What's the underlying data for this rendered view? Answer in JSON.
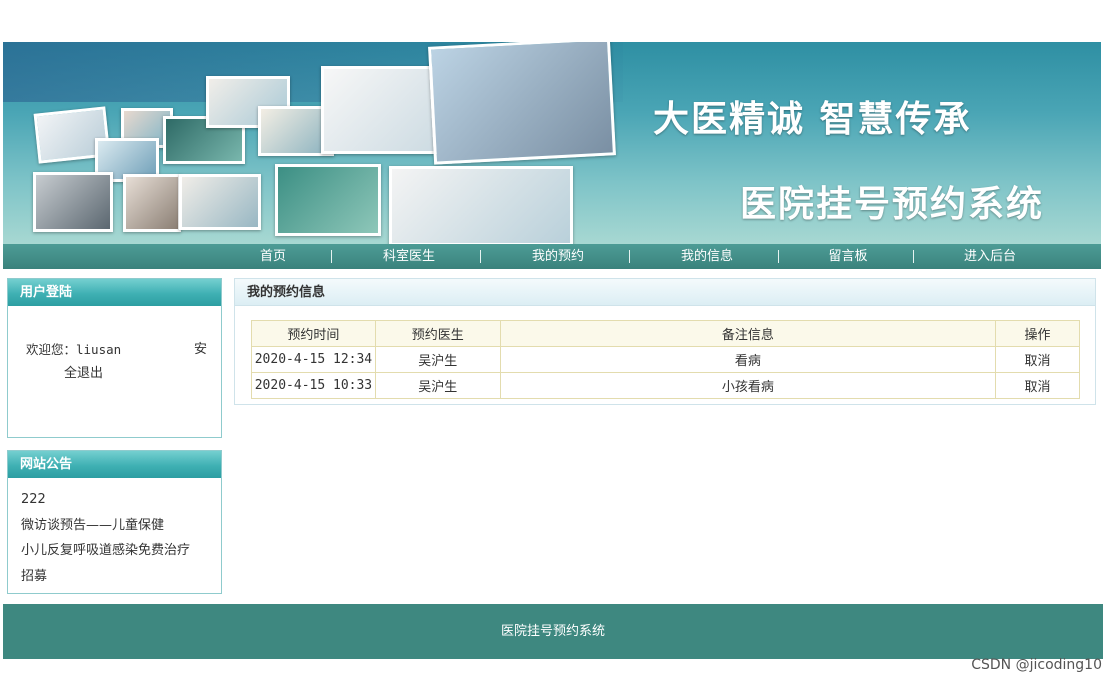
{
  "banner": {
    "slogan_top": "大医精诚 智慧传承",
    "slogan_bottom": "医院挂号预约系统"
  },
  "nav": {
    "items": [
      {
        "label": "首页"
      },
      {
        "label": "科室医生"
      },
      {
        "label": "我的预约"
      },
      {
        "label": "我的信息"
      },
      {
        "label": "留言板"
      },
      {
        "label": "进入后台"
      }
    ],
    "separator": "|"
  },
  "login_panel": {
    "title": "用户登陆",
    "welcome": "欢迎您：liusan",
    "logout_part1": "安",
    "logout_part2": "全退出"
  },
  "notice_panel": {
    "title": "网站公告",
    "items": [
      {
        "text": "222"
      },
      {
        "text": "微访谈预告——儿童保健"
      },
      {
        "text": "小儿反复呼吸道感染免费治疗"
      },
      {
        "text": "招募"
      }
    ]
  },
  "main": {
    "title": "我的预约信息",
    "columns": [
      "预约时间",
      "预约医生",
      "备注信息",
      "操作"
    ],
    "rows": [
      {
        "time": "2020-4-15 12:34",
        "doctor": "吴沪生",
        "note": "看病",
        "action": "取消"
      },
      {
        "time": "2020-4-15 10:33",
        "doctor": "吴沪生",
        "note": "小孩看病",
        "action": "取消"
      }
    ]
  },
  "footer": {
    "text": "医院挂号预约系统"
  },
  "watermark": "CSDN @jicoding10",
  "colors": {
    "nav_bg": "#3e8880",
    "panel_head": "#3fb0b3",
    "footer_bg": "#3e8880",
    "table_border": "#e3dcae"
  }
}
